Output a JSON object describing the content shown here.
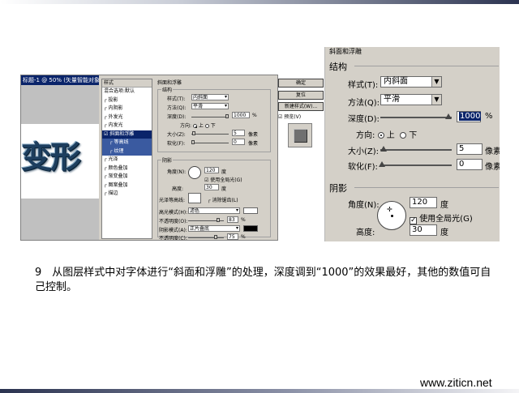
{
  "left_shot": {
    "doc_title": "标题-1 @ 50% (矢量智能对象",
    "canvas_text": "变形",
    "style_list": {
      "header": "样式",
      "items": [
        {
          "label": "混合选项:默认",
          "checked": false
        },
        {
          "label": "投影",
          "checked": false
        },
        {
          "label": "内阴影",
          "checked": false
        },
        {
          "label": "外发光",
          "checked": false
        },
        {
          "label": "内发光",
          "checked": false
        },
        {
          "label": "斜面和浮雕",
          "checked": true,
          "selected": true
        },
        {
          "label": "等高线",
          "checked": false,
          "sub": true
        },
        {
          "label": "纹理",
          "checked": false,
          "sub": true
        },
        {
          "label": "光泽",
          "checked": false
        },
        {
          "label": "颜色叠加",
          "checked": false
        },
        {
          "label": "渐变叠加",
          "checked": false
        },
        {
          "label": "图案叠加",
          "checked": false
        },
        {
          "label": "描边",
          "checked": false
        }
      ]
    },
    "panel": {
      "title": "斜面和浮雕",
      "structure_title": "结构",
      "style_label": "样式(T):",
      "style_value": "内斜面",
      "technique_label": "方法(Q):",
      "technique_value": "平滑",
      "depth_label": "深度(D):",
      "depth_value": "1000",
      "depth_unit": "%",
      "direction_label": "方向:",
      "dir_up": "上",
      "dir_down": "下",
      "size_label": "大小(Z):",
      "size_value": "5",
      "size_unit": "像素",
      "soften_label": "软化(F):",
      "soften_value": "0",
      "soften_unit": "像素",
      "shading_title": "阴影",
      "angle_label": "角度(N):",
      "angle_value": "120",
      "angle_unit": "度",
      "global_light": "使用全局光(G)",
      "altitude_label": "高度:",
      "altitude_value": "30",
      "altitude_unit": "度",
      "gloss_label": "光泽等高线:",
      "antialias": "消除锯齿(L)",
      "highlight_label": "高光模式(H):",
      "highlight_value": "滤色",
      "hl_opacity_label": "不透明度(O):",
      "hl_opacity_value": "83",
      "hl_opacity_unit": "%",
      "shadow_label": "阴影模式(A):",
      "shadow_value": "正片叠底",
      "sh_opacity_label": "不透明度(C):",
      "sh_opacity_value": "75",
      "sh_opacity_unit": "%"
    },
    "buttons": {
      "ok": "确定",
      "reset": "复位",
      "new_style": "新建样式(W)...",
      "preview": "预览(V)"
    }
  },
  "right_shot": {
    "title": "斜面和浮雕",
    "structure_title": "结构",
    "style_label": "样式(T):",
    "style_value": "内斜面",
    "technique_label": "方法(Q):",
    "technique_value": "平滑",
    "depth_label": "深度(D):",
    "depth_value": "1000",
    "depth_unit": "%",
    "direction_label": "方向:",
    "dir_up": "上",
    "dir_down": "下",
    "size_label": "大小(Z):",
    "size_value": "5",
    "size_unit": "像素",
    "soften_label": "软化(F):",
    "soften_value": "0",
    "soften_unit": "像素",
    "shading_title": "阴影",
    "angle_label": "角度(N):",
    "angle_value": "120",
    "angle_unit": "度",
    "global_light": "使用全局光(G)",
    "altitude_label": "高度:",
    "altitude_value": "30",
    "altitude_unit": "度"
  },
  "caption": "9　从图层样式中对字体进行“斜面和浮雕”的处理，深度调到“1000”的效果最好，其他的数值可自己控制。",
  "footer": "www.ziticn.net",
  "colors": {
    "dialog_bg": "#d4d0c8",
    "selection": "#0a246a",
    "bevel_text": "#1d3e5e"
  }
}
